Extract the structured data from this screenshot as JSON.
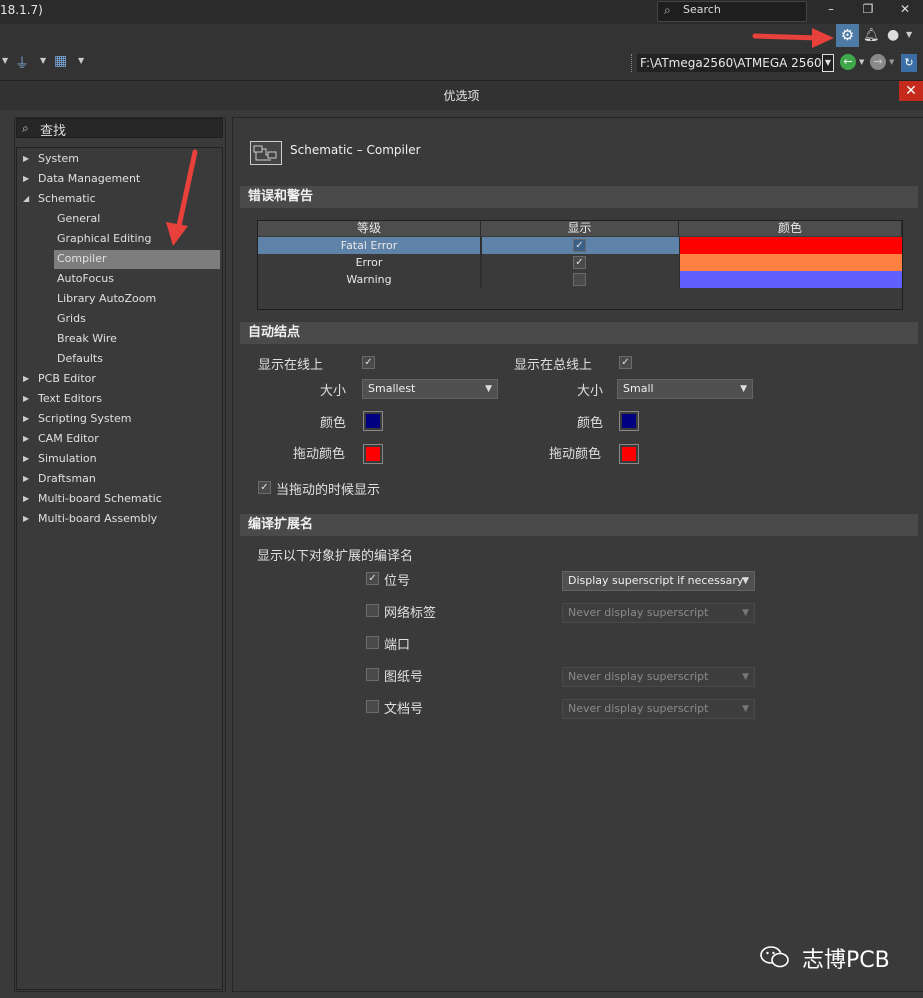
{
  "titlebar": {
    "app_version": "18.1.7)",
    "search_placeholder": "Search",
    "min": "–",
    "restore": "❐",
    "close": "✕"
  },
  "icons": {
    "gear": "gear-icon",
    "bell": "bell-icon",
    "user": "user-icon",
    "search": "search-icon"
  },
  "toolbar": {
    "path": "F:\\ATmega2560\\ATMEGA 2560."
  },
  "dialog": {
    "title": "优选项"
  },
  "tree": {
    "search_placeholder": "查找",
    "items": [
      {
        "label": "System"
      },
      {
        "label": "Data Management"
      },
      {
        "label": "Schematic"
      },
      {
        "label": "General"
      },
      {
        "label": "Graphical Editing"
      },
      {
        "label": "Compiler"
      },
      {
        "label": "AutoFocus"
      },
      {
        "label": "Library AutoZoom"
      },
      {
        "label": "Grids"
      },
      {
        "label": "Break Wire"
      },
      {
        "label": "Defaults"
      },
      {
        "label": "PCB Editor"
      },
      {
        "label": "Text Editors"
      },
      {
        "label": "Scripting System"
      },
      {
        "label": "CAM Editor"
      },
      {
        "label": "Simulation"
      },
      {
        "label": "Draftsman"
      },
      {
        "label": "Multi-board Schematic"
      },
      {
        "label": "Multi-board Assembly"
      }
    ],
    "selected": "Compiler"
  },
  "page": {
    "title": "Schematic – Compiler"
  },
  "errors": {
    "section": "错误和警告",
    "headers": [
      "等级",
      "显示",
      "颜色"
    ],
    "rows": [
      {
        "level": "Fatal Error",
        "show": true,
        "color": "#ff0000"
      },
      {
        "level": "Error",
        "show": true,
        "color": "#ff8040"
      },
      {
        "level": "Warning",
        "show": false,
        "color": "#6060ff"
      }
    ]
  },
  "autojunction": {
    "section": "自动结点",
    "wire": {
      "label": "显示在线上",
      "checked": true,
      "size_label": "大小",
      "size": "Smallest",
      "color_label": "颜色",
      "color": "#000080",
      "drag_label": "拖动颜色",
      "drag_color": "#ff0000"
    },
    "bus": {
      "label": "显示在总线上",
      "checked": true,
      "size_label": "大小",
      "size": "Small",
      "color_label": "颜色",
      "color": "#000080",
      "drag_label": "拖动颜色",
      "drag_color": "#ff0000"
    },
    "show_when_dragging": "当拖动的时候显示",
    "show_when_dragging_checked": true
  },
  "compiled_names": {
    "section": "编译扩展名",
    "description": "显示以下对象扩展的编译名",
    "rows": [
      {
        "label": "位号",
        "checked": true,
        "option": "Display superscript if necessary",
        "enabled": true
      },
      {
        "label": "网络标签",
        "checked": false,
        "option": "Never display superscript",
        "enabled": false
      },
      {
        "label": "端口",
        "checked": false,
        "option": "",
        "enabled": false
      },
      {
        "label": "图纸号",
        "checked": false,
        "option": "Never display superscript",
        "enabled": false
      },
      {
        "label": "文档号",
        "checked": false,
        "option": "Never display superscript",
        "enabled": false
      }
    ]
  },
  "watermark": "志博PCB",
  "accent": "#e8403a"
}
